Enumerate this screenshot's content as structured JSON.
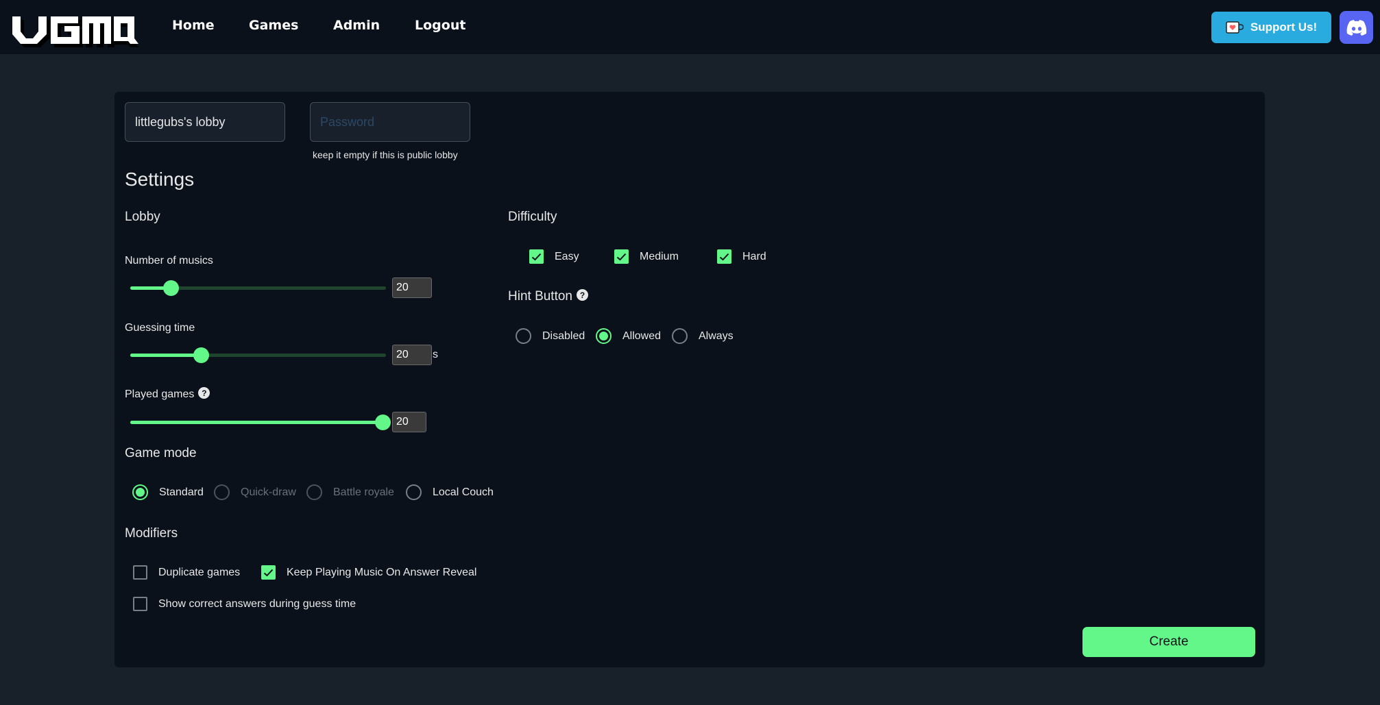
{
  "nav": {
    "logo_text": "VGMQ",
    "links": [
      "Home",
      "Games",
      "Admin",
      "Logout"
    ],
    "support_label": "Support Us!",
    "support_icon": "ko-fi-cup-icon",
    "discord_icon": "discord-icon"
  },
  "lobby": {
    "name_value": "littlegubs's lobby",
    "password_placeholder": "Password",
    "password_value": "",
    "password_hint": "keep it empty if this is public lobby"
  },
  "settings": {
    "title": "Settings",
    "lobby_heading": "Lobby",
    "number_of_musics": {
      "label": "Number of musics",
      "value": "20",
      "fraction": 0.16
    },
    "guessing_time": {
      "label": "Guessing time",
      "value": "20",
      "suffix": "s",
      "fraction": 0.28
    },
    "played_games": {
      "label": "Played games",
      "value": "20",
      "fraction": 1.0
    },
    "game_mode": {
      "heading": "Game mode",
      "options": [
        {
          "label": "Standard",
          "selected": true,
          "disabled": false
        },
        {
          "label": "Quick-draw",
          "selected": false,
          "disabled": true
        },
        {
          "label": "Battle royale",
          "selected": false,
          "disabled": true
        },
        {
          "label": "Local Couch",
          "selected": false,
          "disabled": false
        }
      ]
    },
    "modifiers": {
      "heading": "Modifiers",
      "options": [
        {
          "label": "Duplicate games",
          "checked": false
        },
        {
          "label": "Keep Playing Music On Answer Reveal",
          "checked": true
        },
        {
          "label": "Show correct answers during guess time",
          "checked": false
        }
      ]
    },
    "difficulty": {
      "heading": "Difficulty",
      "options": [
        {
          "label": "Easy",
          "checked": true
        },
        {
          "label": "Medium",
          "checked": true
        },
        {
          "label": "Hard",
          "checked": true
        }
      ]
    },
    "hint_button": {
      "heading": "Hint Button",
      "options": [
        {
          "label": "Disabled",
          "selected": false
        },
        {
          "label": "Allowed",
          "selected": true
        },
        {
          "label": "Always",
          "selected": false
        }
      ]
    },
    "help_glyph": "?"
  },
  "actions": {
    "create_label": "Create"
  },
  "colors": {
    "accent": "#63f78a",
    "support": "#29abe0",
    "discord": "#5865f2"
  }
}
